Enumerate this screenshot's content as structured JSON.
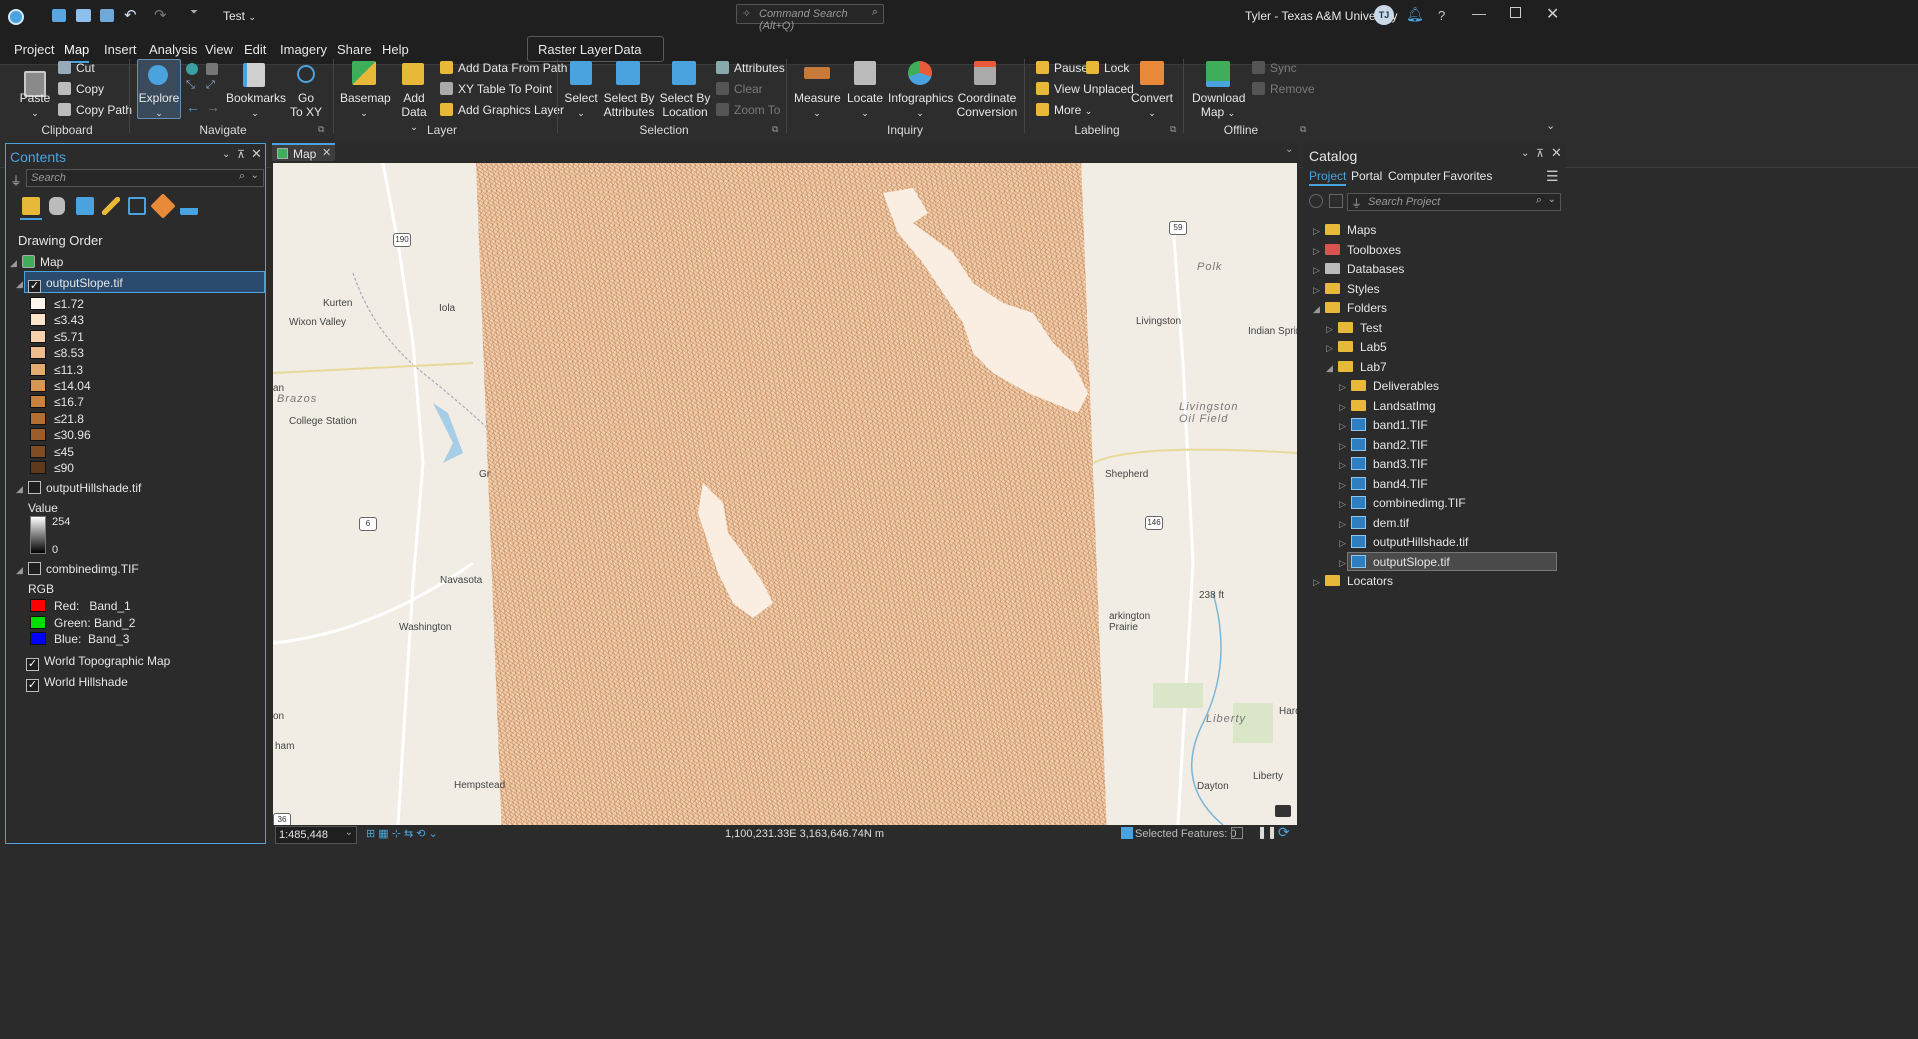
{
  "title_bar": {
    "project_name": "Test",
    "command_search_placeholder": "Command Search (Alt+Q)",
    "user": "Tyler - Texas A&M University",
    "avatar_initials": "TJ"
  },
  "menu": {
    "items": [
      "Project",
      "Map",
      "Insert",
      "Analysis",
      "View",
      "Edit",
      "Imagery",
      "Share",
      "Help"
    ],
    "active": "Map",
    "contextual": [
      "Raster Layer",
      "Data"
    ]
  },
  "ribbon": {
    "clipboard": {
      "paste": "Paste",
      "cut": "Cut",
      "copy": "Copy",
      "copy_path": "Copy Path",
      "label": "Clipboard"
    },
    "navigate": {
      "explore": "Explore",
      "bookmarks": "Bookmarks",
      "goto": "Go\nTo XY",
      "label": "Navigate"
    },
    "layer": {
      "basemap": "Basemap",
      "add_data": "Add\nData",
      "add_path": "Add Data From Path",
      "xy_table": "XY Table To Point",
      "graphics": "Add Graphics Layer",
      "label": "Layer"
    },
    "selection": {
      "select": "Select",
      "by_attr": "Select By\nAttributes",
      "by_loc": "Select By\nLocation",
      "attributes": "Attributes",
      "clear": "Clear",
      "zoom_to": "Zoom To",
      "label": "Selection"
    },
    "inquiry": {
      "measure": "Measure",
      "locate": "Locate",
      "infographics": "Infographics",
      "coord": "Coordinate\nConversion",
      "label": "Inquiry"
    },
    "labeling": {
      "pause": "Pause",
      "lock": "Lock",
      "view_unplaced": "View Unplaced",
      "more": "More",
      "convert": "Convert",
      "label": "Labeling"
    },
    "offline": {
      "download": "Download\nMap",
      "sync": "Sync",
      "remove": "Remove",
      "label": "Offline"
    }
  },
  "contents": {
    "title": "Contents",
    "search_placeholder": "Search",
    "drawing_order": "Drawing Order",
    "map_name": "Map",
    "slope_layer": "outputSlope.tif",
    "slope_classes": [
      {
        "label": "≤1.72",
        "color": "#fff5ec"
      },
      {
        "label": "≤3.43",
        "color": "#fbe3cc"
      },
      {
        "label": "≤5.71",
        "color": "#f6d1ae"
      },
      {
        "label": "≤8.53",
        "color": "#edbd8d"
      },
      {
        "label": "≤11.3",
        "color": "#e3aa72"
      },
      {
        "label": "≤14.04",
        "color": "#d69655"
      },
      {
        "label": "≤16.7",
        "color": "#c8823f"
      },
      {
        "label": "≤21.8",
        "color": "#b36f33"
      },
      {
        "label": "≤30.96",
        "color": "#9a5d2b"
      },
      {
        "label": "≤45",
        "color": "#7f4c24"
      },
      {
        "label": "≤90",
        "color": "#5e391c"
      }
    ],
    "hillshade_layer": "outputHillshade.tif",
    "value_label": "Value",
    "hillshade_max": "254",
    "hillshade_min": "0",
    "combined_layer": "combinedimg.TIF",
    "rgb_label": "RGB",
    "bands": [
      {
        "label": "Red:   Band_1",
        "color": "#ff0000"
      },
      {
        "label": "Green: Band_2",
        "color": "#00e000"
      },
      {
        "label": "Blue:  Band_3",
        "color": "#0000ff"
      }
    ],
    "topo_layer": "World Topographic Map",
    "hillshade_basemap": "World Hillshade"
  },
  "map_view": {
    "tab": "Map",
    "scale": "1:485,448",
    "coordinates": "1,100,231.33E 3,163,646.74N m",
    "selected_features": "Selected Features: 0",
    "labels": {
      "kurten": "Kurten",
      "iola": "Iola",
      "wixon": "Wixon Valley",
      "brazos": "Brazos",
      "college": "College Station",
      "navasota": "Navasota",
      "washington": "Washington",
      "hempstead": "Hempstead",
      "ham": "ham",
      "an": "an",
      "on": "on",
      "gr": "Gr",
      "livingston": "Livingston",
      "indian": "Indian Springs",
      "polk": "Polk",
      "oilfield": "Livingston\nOil Field",
      "shepherd": "Shepherd",
      "arlington": "arkington\nPrairie",
      "liberty": "Liberty",
      "dayton": "Dayton",
      "libertytown": "Liberty",
      "hardin": "Hardi",
      "ft238": "238 ft"
    },
    "shields": {
      "s190": "190",
      "s59": "59",
      "s6": "6",
      "s146": "146",
      "s36": "36"
    }
  },
  "catalog": {
    "title": "Catalog",
    "tabs": [
      "Project",
      "Portal",
      "Computer",
      "Favorites"
    ],
    "active_tab": "Project",
    "search_placeholder": "Search Project",
    "items": [
      {
        "label": "Maps",
        "indent": 0,
        "kind": "maps"
      },
      {
        "label": "Toolboxes",
        "indent": 0,
        "kind": "toolbox"
      },
      {
        "label": "Databases",
        "indent": 0,
        "kind": "db"
      },
      {
        "label": "Styles",
        "indent": 0,
        "kind": "styles"
      },
      {
        "label": "Folders",
        "indent": 0,
        "kind": "folder",
        "open": true
      },
      {
        "label": "Test",
        "indent": 1,
        "kind": "folderhome"
      },
      {
        "label": "Lab5",
        "indent": 1,
        "kind": "folder"
      },
      {
        "label": "Lab7",
        "indent": 1,
        "kind": "folder",
        "open": true
      },
      {
        "label": "Deliverables",
        "indent": 2,
        "kind": "folder"
      },
      {
        "label": "LandsatImg",
        "indent": 2,
        "kind": "folder"
      },
      {
        "label": "band1.TIF",
        "indent": 2,
        "kind": "tif"
      },
      {
        "label": "band2.TIF",
        "indent": 2,
        "kind": "tif"
      },
      {
        "label": "band3.TIF",
        "indent": 2,
        "kind": "tif"
      },
      {
        "label": "band4.TIF",
        "indent": 2,
        "kind": "tif"
      },
      {
        "label": "combinedimg.TIF",
        "indent": 2,
        "kind": "tif"
      },
      {
        "label": "dem.tif",
        "indent": 2,
        "kind": "tif"
      },
      {
        "label": "outputHillshade.tif",
        "indent": 2,
        "kind": "tif"
      },
      {
        "label": "outputSlope.tif",
        "indent": 2,
        "kind": "tif",
        "selected": true
      },
      {
        "label": "Locators",
        "indent": 0,
        "kind": "locator"
      }
    ]
  }
}
